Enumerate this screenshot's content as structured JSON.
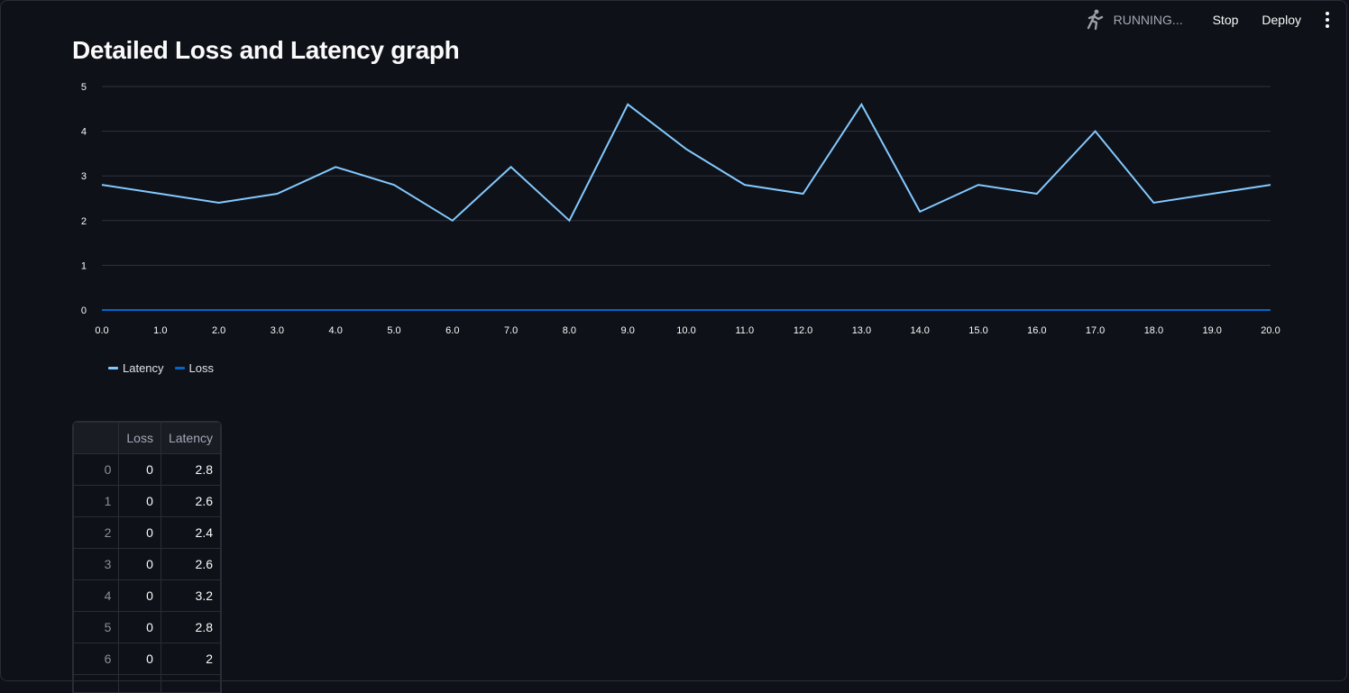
{
  "toolbar": {
    "status_label": "RUNNING...",
    "stop_label": "Stop",
    "deploy_label": "Deploy",
    "status_icon": "running-man-icon",
    "menu_icon": "vertical-dots-icon"
  },
  "page": {
    "title": "Detailed Loss and Latency graph"
  },
  "colors": {
    "latency": "#83c9ff",
    "loss": "#0068c9",
    "grid": "#31333f",
    "axis_text": "#fafafa"
  },
  "chart_data": {
    "type": "line",
    "x": [
      0,
      1,
      2,
      3,
      4,
      5,
      6,
      7,
      8,
      9,
      10,
      11,
      12,
      13,
      14,
      15,
      16,
      17,
      18,
      19,
      20
    ],
    "x_tick_labels": [
      "0.0",
      "1.0",
      "2.0",
      "3.0",
      "4.0",
      "5.0",
      "6.0",
      "7.0",
      "8.0",
      "9.0",
      "10.0",
      "11.0",
      "12.0",
      "13.0",
      "14.0",
      "15.0",
      "16.0",
      "17.0",
      "18.0",
      "19.0",
      "20.0"
    ],
    "y_ticks": [
      0,
      1,
      2,
      3,
      4,
      5
    ],
    "ylim": [
      0,
      5
    ],
    "xlim": [
      0,
      20
    ],
    "grid": true,
    "legend_position": "bottom-left",
    "series": [
      {
        "name": "Latency",
        "values": [
          2.8,
          2.6,
          2.4,
          2.6,
          3.2,
          2.8,
          2,
          3.2,
          2,
          4.6,
          3.6,
          2.8,
          2.6,
          4.6,
          2.2,
          2.8,
          2.6,
          4.0,
          2.4,
          2.6,
          2.8
        ]
      },
      {
        "name": "Loss",
        "values": [
          0,
          0,
          0,
          0,
          0,
          0,
          0,
          0,
          0,
          0,
          0,
          0,
          0,
          0,
          0,
          0,
          0,
          0,
          0,
          0,
          0
        ]
      }
    ]
  },
  "table": {
    "columns": [
      "",
      "Loss",
      "Latency"
    ],
    "rows": [
      [
        "0",
        "0",
        "2.8"
      ],
      [
        "1",
        "0",
        "2.6"
      ],
      [
        "2",
        "0",
        "2.4"
      ],
      [
        "3",
        "0",
        "2.6"
      ],
      [
        "4",
        "0",
        "3.2"
      ],
      [
        "5",
        "0",
        "2.8"
      ],
      [
        "6",
        "0",
        "2"
      ],
      [
        "",
        "",
        ""
      ]
    ]
  }
}
